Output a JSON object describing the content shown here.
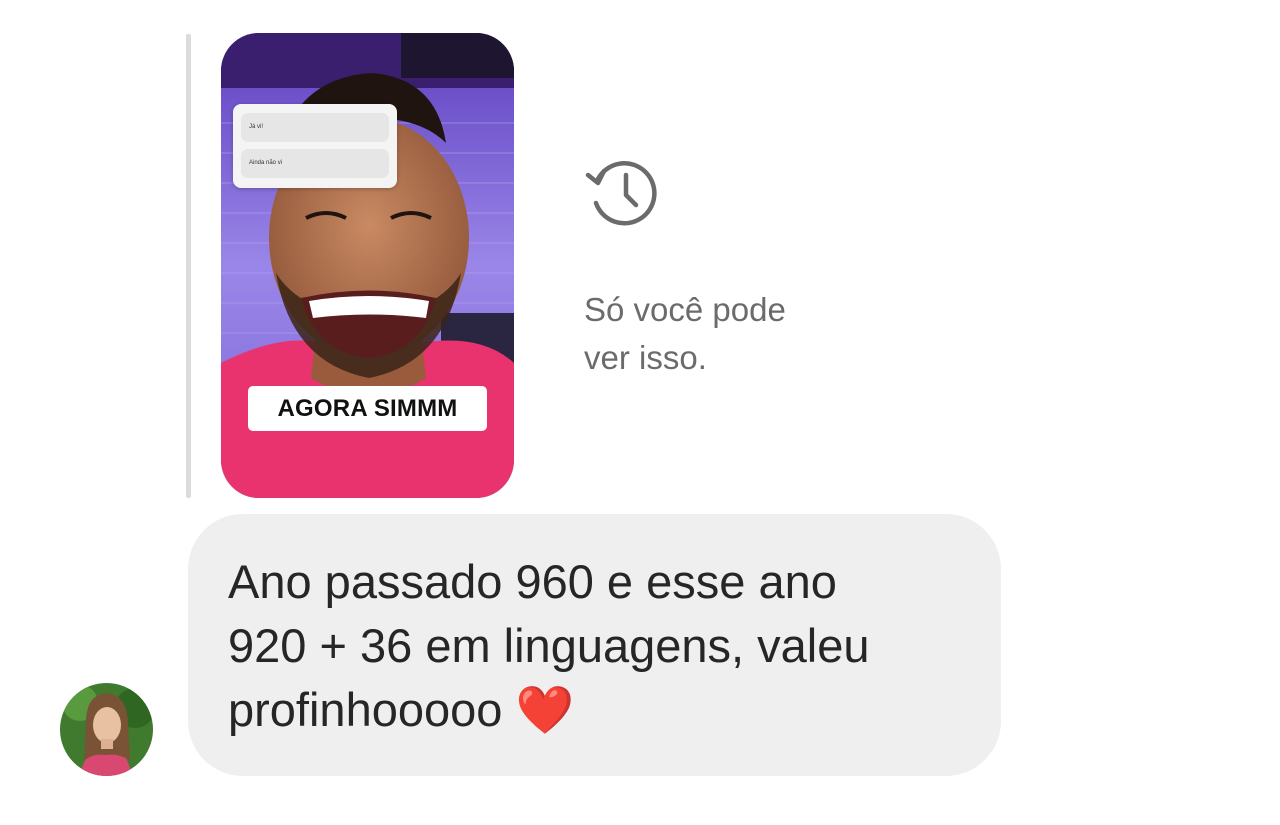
{
  "story_reply": {
    "poll": {
      "option_1": "Já vi!",
      "option_2": "Ainda não vi"
    },
    "caption": "AGORA SIMMM",
    "expired_icon": "history-icon",
    "expired_message": "Só você pode\nver isso."
  },
  "message": {
    "text": "Ano passado 960 e esse ano\n920 + 36 em linguagens, valeu\nprofinhooooo ❤️"
  },
  "avatar": {
    "icon": "profile-photo"
  },
  "colors": {
    "bubble_bg": "#efefef",
    "text_primary": "#262626",
    "text_secondary": "#6b6b6b",
    "story_pink": "#e8336e",
    "story_purple": "#7a5bd6"
  }
}
